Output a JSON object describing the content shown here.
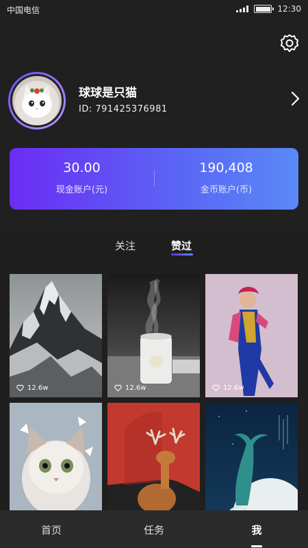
{
  "status_bar": {
    "carrier": "中国电信",
    "time": "12:30",
    "battery_level": 1.0
  },
  "profile": {
    "username": "球球是只猫",
    "user_id": "ID:  791425376981"
  },
  "account_card": {
    "cash_value": "30.00",
    "cash_label": "现金账户(元)",
    "coin_value": "190,408",
    "coin_label": "金币账户(币)"
  },
  "tabs": [
    {
      "label": "关注",
      "active": false
    },
    {
      "label": "赞过",
      "active": true
    }
  ],
  "grid": {
    "items": [
      {
        "subject": "snowy mountain",
        "likes": "12.6w"
      },
      {
        "subject": "humidifier with steam",
        "likes": "12.6w"
      },
      {
        "subject": "woman in qipao",
        "likes": "12.6w"
      },
      {
        "subject": "kitten",
        "likes": ""
      },
      {
        "subject": "deer on red background",
        "likes": ""
      },
      {
        "subject": "whale tail illustration",
        "likes": ""
      }
    ]
  },
  "bottom_nav": {
    "items": [
      {
        "label": "首页",
        "active": false
      },
      {
        "label": "任务",
        "active": false
      },
      {
        "label": "我",
        "active": true
      }
    ]
  },
  "colors": {
    "background": "#1f1f1f",
    "card_start": "#6b2cf5",
    "card_end": "#5a89f7",
    "nav_bg": "#2b2b2b"
  }
}
